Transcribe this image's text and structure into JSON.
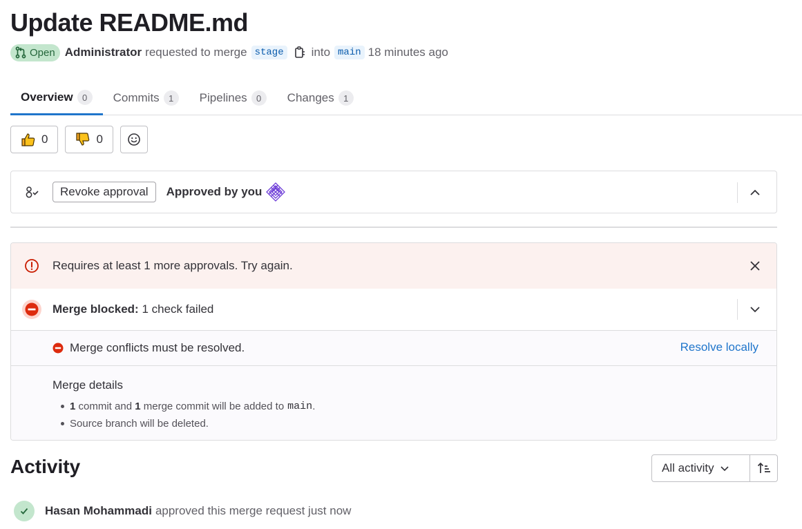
{
  "header": {
    "title": "Update README.md",
    "status": "Open",
    "author": "Administrator",
    "action_text": "requested to merge",
    "source_branch": "stage",
    "into_text": "into",
    "target_branch": "main",
    "time": "18 minutes ago"
  },
  "tabs": [
    {
      "label": "Overview",
      "count": "0"
    },
    {
      "label": "Commits",
      "count": "1"
    },
    {
      "label": "Pipelines",
      "count": "0"
    },
    {
      "label": "Changes",
      "count": "1"
    }
  ],
  "reactions": {
    "thumbs_up": "0",
    "thumbs_down": "0"
  },
  "approval": {
    "revoke_label": "Revoke approval",
    "approved_by": "Approved by you"
  },
  "merge": {
    "alert": "Requires at least 1 more approvals. Try again.",
    "blocked_bold": "Merge blocked:",
    "blocked_rest": "1 check failed",
    "conflict": "Merge conflicts must be resolved.",
    "resolve_link": "Resolve locally",
    "details_title": "Merge details",
    "detail_1": {
      "count_a": "1",
      "text_a": "commit and",
      "count_b": "1",
      "text_b": "merge commit will be added to",
      "branch": "main",
      "end": "."
    },
    "detail_2": "Source branch will be deleted."
  },
  "activity": {
    "title": "Activity",
    "filter_label": "All activity",
    "event_user": "Hasan Mohammadi",
    "event_text": "approved this merge request just now"
  },
  "colors": {
    "accent": "#1f75cb",
    "success_bg": "#c3e6cd",
    "success_text": "#24663b",
    "danger": "#dd2b0e",
    "alert_bg": "#fcf1ef"
  }
}
